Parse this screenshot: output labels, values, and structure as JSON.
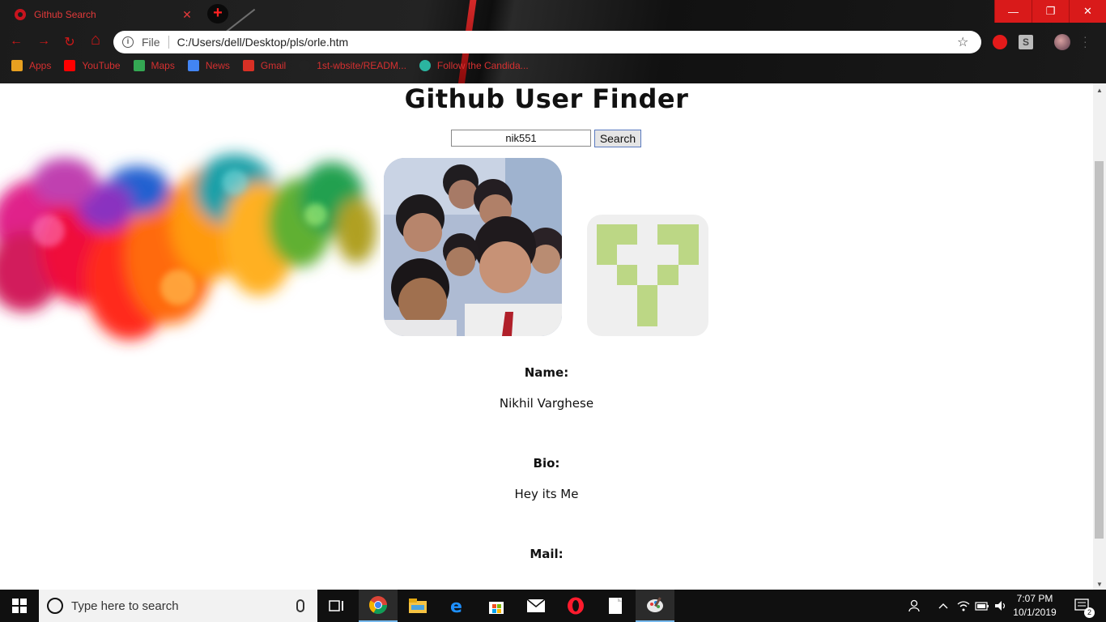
{
  "browser": {
    "tab_title": "Github Search",
    "tab_close": "✕",
    "new_tab": "+",
    "window_controls": {
      "minimize": "—",
      "restore": "❐",
      "close": "✕"
    },
    "nav": {
      "back": "←",
      "forward": "→",
      "reload": "↻",
      "home": "⌂"
    },
    "address": {
      "info": "i",
      "scheme_label": "File",
      "url": "C:/Users/dell/Desktop/pls/orle.htm",
      "star": "☆"
    },
    "extensions": {
      "s_label": "S"
    },
    "bookmarks": [
      {
        "label": "Apps",
        "icon": "apps-grid-icon",
        "color": "#e8a020"
      },
      {
        "label": "YouTube",
        "icon": "youtube-icon",
        "color": "#ff0000"
      },
      {
        "label": "Maps",
        "icon": "maps-icon",
        "color": "#34a853"
      },
      {
        "label": "News",
        "icon": "news-icon",
        "color": "#4285f4"
      },
      {
        "label": "Gmail",
        "icon": "gmail-icon",
        "color": "#d93025"
      },
      {
        "label": "1st-wbsite/READM...",
        "icon": "github-icon",
        "color": "#222222"
      },
      {
        "label": "Follow the Candida...",
        "icon": "site-icon",
        "color": "#2bb5a0"
      }
    ]
  },
  "page": {
    "title": "Github User Finder",
    "search_value": "nik551",
    "search_button": "Search",
    "name_label": "Name:",
    "name_value": "Nikhil Varghese",
    "bio_label": "Bio:",
    "bio_value": "Hey its Me",
    "mail_label": "Mail:"
  },
  "taskbar": {
    "search_placeholder": "Type here to search",
    "time": "7:07 PM",
    "date": "10/1/2019",
    "notifications": "2"
  }
}
